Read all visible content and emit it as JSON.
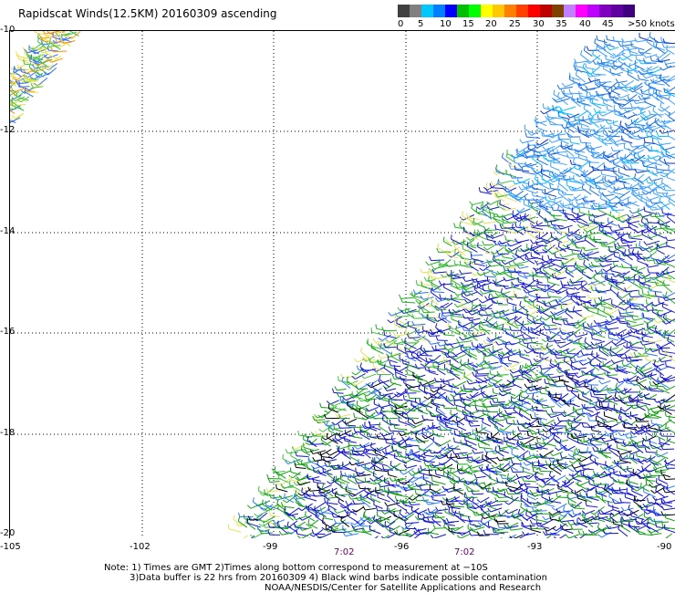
{
  "title": "Rapidscat Winds(12.5KM) 20160309 ascending",
  "colorbar": {
    "colors": [
      "#404040",
      "#808080",
      "#00c8ff",
      "#0080ff",
      "#0000ff",
      "#00c000",
      "#00ff00",
      "#ffff00",
      "#ffc800",
      "#ff8000",
      "#ff4000",
      "#ff0000",
      "#c00000",
      "#804000",
      "#c080ff",
      "#ff00ff",
      "#c000ff",
      "#8000c0",
      "#6000a0",
      "#400080"
    ],
    "ticks": [
      "0",
      "5",
      "10",
      "15",
      "20",
      "25",
      "30",
      "35",
      "40",
      "45",
      ">50 knots"
    ]
  },
  "map": {
    "lat_labels": [
      "-10",
      "-12",
      "-14",
      "-16",
      "-18",
      "-20"
    ],
    "lon_labels": [
      "-105",
      "-102",
      "-99",
      "-96",
      "-93",
      "-90"
    ],
    "time_labels": [
      "7:02",
      "7:02"
    ]
  },
  "notes": {
    "line1": "Note: 1) Times are GMT 2)Times along bottom correspond to measurement at −10S",
    "line2": "3)Data buffer is 22 hrs from 20160309 4) Black wind barbs indicate possible contamination",
    "line3": "NOAA/NESDIS/Center for Satellite Applications and Research"
  }
}
